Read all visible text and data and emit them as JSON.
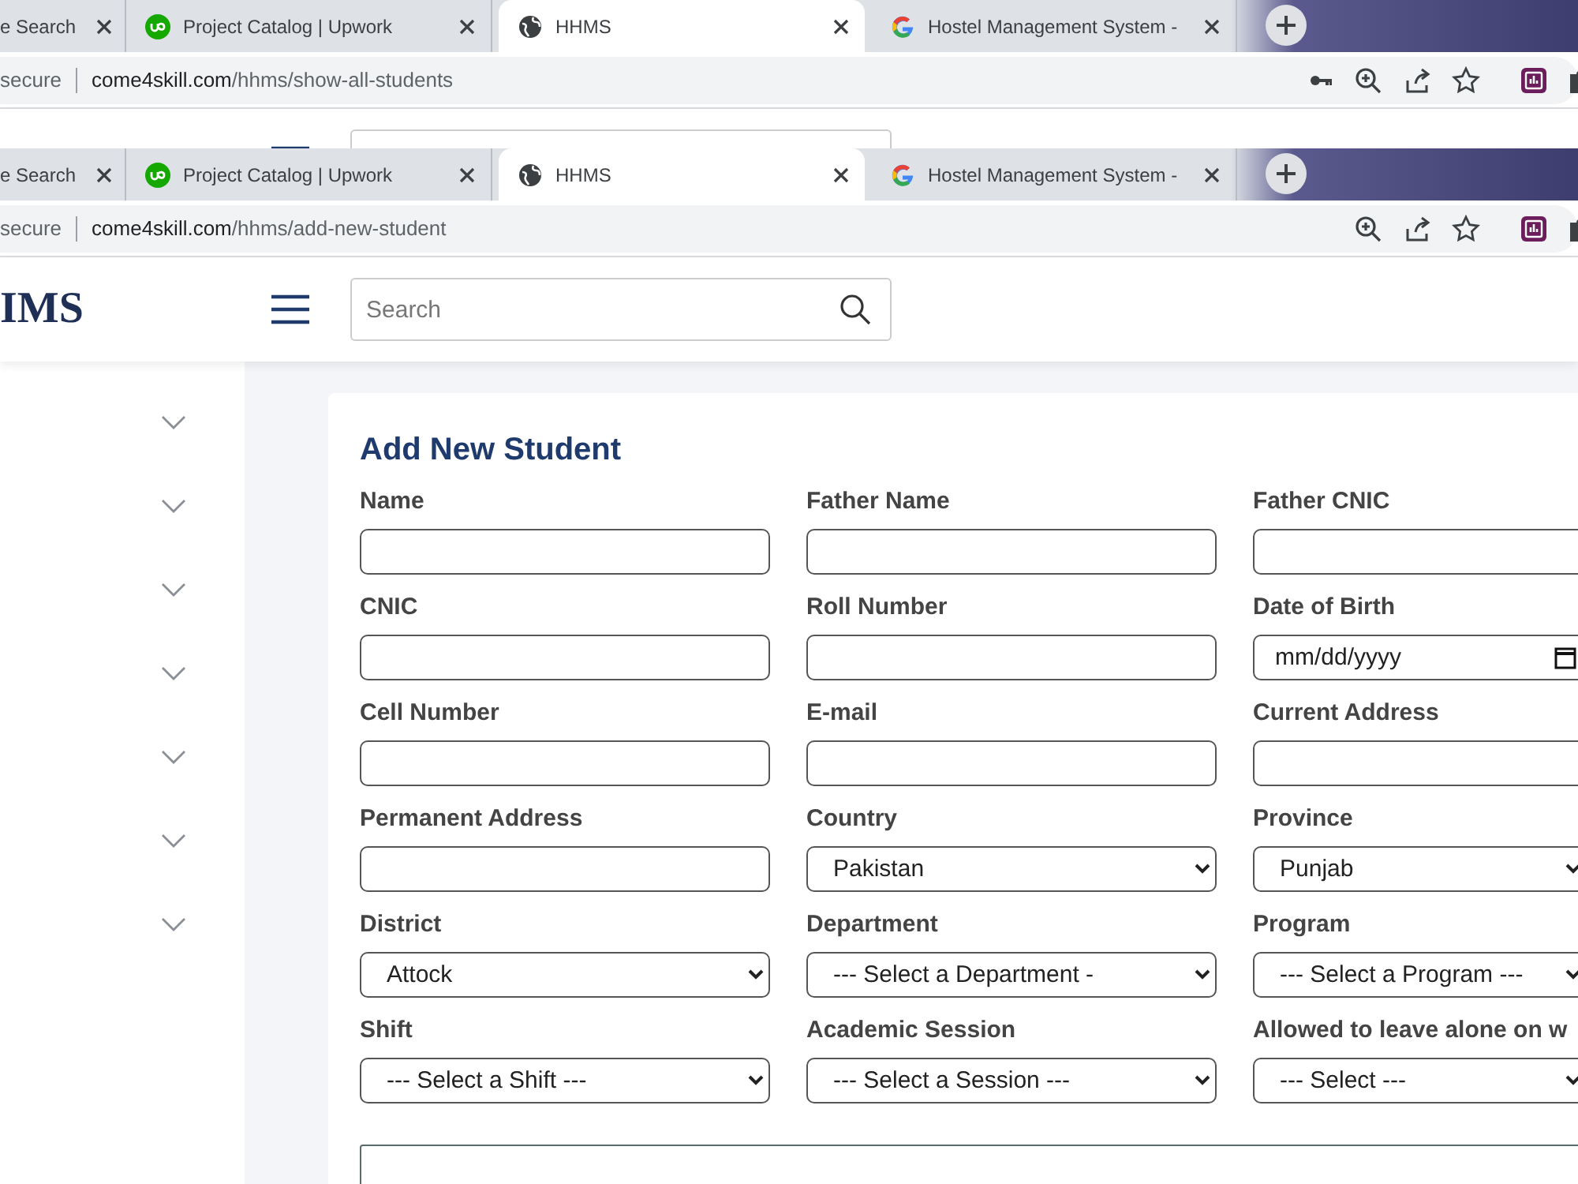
{
  "browsers": [
    {
      "tabs": [
        {
          "label": "e Search",
          "kind": "plain",
          "selected": false
        },
        {
          "label": "Project Catalog | Upwork",
          "kind": "upwork",
          "selected": false
        },
        {
          "label": "HHMS",
          "kind": "globe",
          "selected": true
        },
        {
          "label": "Hostel Management System -",
          "kind": "google",
          "selected": false
        }
      ],
      "address": {
        "security": "secure",
        "host": "come4skill.com",
        "path": "/hhms/show-all-students"
      },
      "toolbar": [
        {
          "kind": "key"
        },
        {
          "kind": "zoom"
        },
        {
          "kind": "share"
        },
        {
          "kind": "star"
        },
        {
          "kind": "extension"
        },
        {
          "kind": "puzzle"
        }
      ]
    },
    {
      "tabs": [
        {
          "label": "e Search",
          "kind": "plain",
          "selected": false
        },
        {
          "label": "Project Catalog | Upwork",
          "kind": "upwork",
          "selected": false
        },
        {
          "label": "HHMS",
          "kind": "globe",
          "selected": true
        },
        {
          "label": "Hostel Management System -",
          "kind": "google",
          "selected": false
        }
      ],
      "address": {
        "security": "secure",
        "host": "come4skill.com",
        "path": "/hhms/add-new-student"
      },
      "toolbar": [
        {
          "kind": "zoom"
        },
        {
          "kind": "share"
        },
        {
          "kind": "star"
        },
        {
          "kind": "extension"
        },
        {
          "kind": "puzzle"
        }
      ]
    }
  ],
  "header": {
    "logo": "IMS",
    "search": {
      "placeholder": "Search"
    }
  },
  "sidebar": {
    "items": [
      {
        "expanded": false
      },
      {
        "expanded": false
      },
      {
        "expanded": false
      },
      {
        "expanded": false
      },
      {
        "expanded": false
      },
      {
        "expanded": false
      },
      {
        "expanded": false
      }
    ]
  },
  "form": {
    "title": "Add New Student",
    "fields": [
      {
        "label": "Name",
        "kind": "text"
      },
      {
        "label": "Father Name",
        "kind": "text"
      },
      {
        "label": "Father CNIC",
        "kind": "text"
      },
      {
        "label": "CNIC",
        "kind": "text"
      },
      {
        "label": "Roll Number",
        "kind": "text"
      },
      {
        "label": "Date of Birth",
        "kind": "date",
        "placeholder": "mm/dd/yyyy"
      },
      {
        "label": "Cell Number",
        "kind": "text"
      },
      {
        "label": "E-mail",
        "kind": "text"
      },
      {
        "label": "Current Address",
        "kind": "text"
      },
      {
        "label": "Permanent Address",
        "kind": "text"
      },
      {
        "label": "Country",
        "kind": "select",
        "value": "Pakistan"
      },
      {
        "label": "Province",
        "kind": "select",
        "value": "Punjab"
      },
      {
        "label": "District",
        "kind": "select",
        "value": "Attock"
      },
      {
        "label": "Department",
        "kind": "select",
        "value": "--- Select a Department -"
      },
      {
        "label": "Program",
        "kind": "select",
        "value": "--- Select a Program ---"
      },
      {
        "label": "Shift",
        "kind": "select",
        "value": "--- Select a Shift ---"
      },
      {
        "label": "Academic Session",
        "kind": "select",
        "value": "--- Select a Session ---"
      },
      {
        "label": "Allowed to leave alone on w",
        "kind": "select",
        "value": "--- Select ---"
      },
      {
        "kind": "textarea"
      }
    ]
  }
}
